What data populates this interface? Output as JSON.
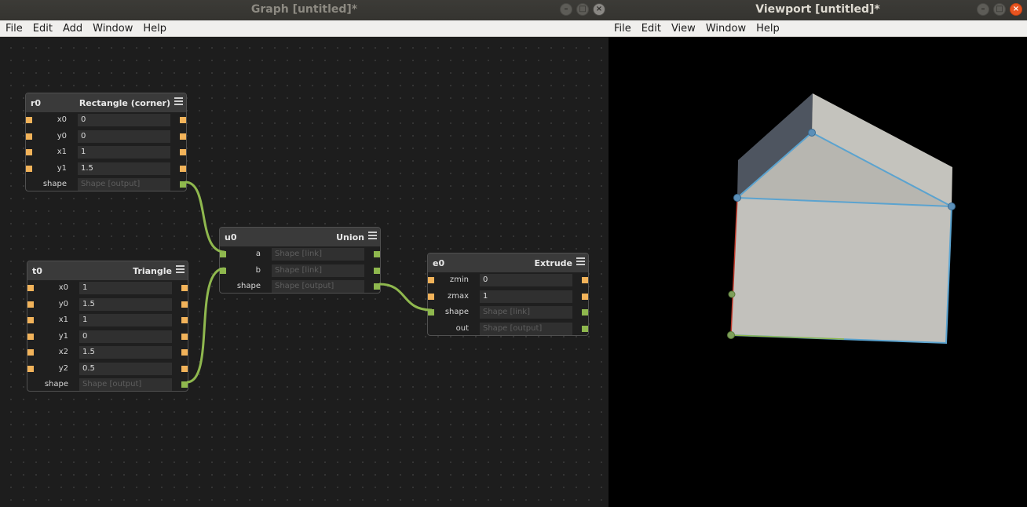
{
  "graph_window": {
    "title": "Graph [untitled]*",
    "menu": [
      "File",
      "Edit",
      "Add",
      "Window",
      "Help"
    ]
  },
  "viewport_window": {
    "title": "Viewport [untitled]*",
    "menu": [
      "File",
      "Edit",
      "View",
      "Window",
      "Help"
    ]
  },
  "window_buttons": {
    "minimize": "–",
    "maximize": "□",
    "close": "×"
  },
  "nodes": {
    "r0": {
      "id": "r0",
      "type": "Rectangle (corner)",
      "rows": [
        {
          "label": "x0",
          "value": "0"
        },
        {
          "label": "y0",
          "value": "0"
        },
        {
          "label": "x1",
          "value": "1"
        },
        {
          "label": "y1",
          "value": "1.5"
        },
        {
          "label": "shape",
          "value": "Shape [output]"
        }
      ]
    },
    "t0": {
      "id": "t0",
      "type": "Triangle",
      "rows": [
        {
          "label": "x0",
          "value": "1"
        },
        {
          "label": "y0",
          "value": "1.5"
        },
        {
          "label": "x1",
          "value": "1"
        },
        {
          "label": "y1",
          "value": "0"
        },
        {
          "label": "x2",
          "value": "1.5"
        },
        {
          "label": "y2",
          "value": "0.5"
        },
        {
          "label": "shape",
          "value": "Shape [output]"
        }
      ]
    },
    "u0": {
      "id": "u0",
      "type": "Union",
      "rows": [
        {
          "label": "a",
          "value": "Shape [link]"
        },
        {
          "label": "b",
          "value": "Shape [link]"
        },
        {
          "label": "shape",
          "value": "Shape [output]"
        }
      ]
    },
    "e0": {
      "id": "e0",
      "type": "Extrude",
      "rows": [
        {
          "label": "zmin",
          "value": "0"
        },
        {
          "label": "zmax",
          "value": "1"
        },
        {
          "label": "shape",
          "value": "Shape [link]"
        },
        {
          "label": "out",
          "value": "Shape [output]"
        }
      ]
    }
  },
  "colors": {
    "number_port": "#f2b35a",
    "shape_port": "#8fb84e",
    "wire": "#8fb84e",
    "accent_close": "#e95420",
    "edge_highlight": "#5ba3cf"
  },
  "icons": {
    "node_menu": "hamburger-icon"
  }
}
